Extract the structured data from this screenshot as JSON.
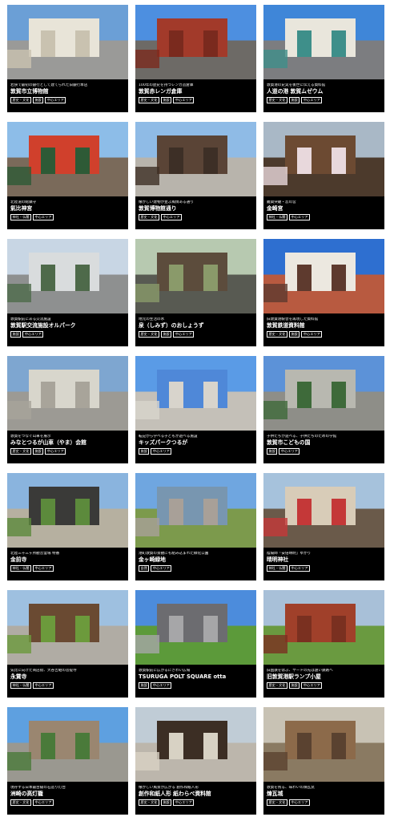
{
  "cards": [
    {
      "caption": "若狭で最初の銀行として建てられた旧銀行本店",
      "title": "敦賀市立博物館",
      "tags": [
        "歴史・文化",
        "施設",
        "中心エリア"
      ],
      "sky": "#6b9fd6",
      "ground": "#9a9a98",
      "building": "#e8e4d8",
      "accent": "#c9c2b0"
    },
    {
      "caption": "100年の歴史を持つレンガ造倉庫",
      "title": "敦賀赤レンガ倉庫",
      "tags": [
        "歴史・文化",
        "施設",
        "中心エリア"
      ],
      "sky": "#4d8fe0",
      "ground": "#6d6a66",
      "building": "#a23a2a",
      "accent": "#7a2a1e"
    },
    {
      "caption": "敦賀港の史実を後世に伝える資料館",
      "title": "人道の港 敦賀ムゼウム",
      "tags": [
        "歴史・文化",
        "施設",
        "中心エリア"
      ],
      "sky": "#3f86d8",
      "ground": "#7c7d80",
      "building": "#e9e6dc",
      "accent": "#3e8f8a"
    },
    {
      "caption": "北陸道の総鎮守",
      "title": "氣比神宮",
      "tags": [
        "神社・仏閣",
        "中心エリア"
      ],
      "sky": "#8dbde8",
      "ground": "#7a6a5a",
      "building": "#d0402c",
      "accent": "#2e5a36"
    },
    {
      "caption": "懐かしい建物が並ぶ風情ある通り",
      "title": "敦賀博物館通り",
      "tags": [
        "歴史・文化",
        "中心エリア"
      ],
      "sky": "#8fbbe6",
      "ground": "#b8b4ac",
      "building": "#5a4436",
      "accent": "#3d2f26"
    },
    {
      "caption": "難関突破・恋の宮",
      "title": "金崎宮",
      "tags": [
        "神社・仏閣",
        "中心エリア"
      ],
      "sky": "#a9b8c6",
      "ground": "#4c3a2c",
      "building": "#6c4a32",
      "accent": "#e8d8dc"
    },
    {
      "caption": "敦賀駅前にある交流施設",
      "title": "敦賀駅交流施設オルパーク",
      "tags": [
        "施設",
        "中心エリア"
      ],
      "sky": "#c8d6e4",
      "ground": "#8e9090",
      "building": "#d9dcdd",
      "accent": "#4e6a4a"
    },
    {
      "caption": "地元の生活の水",
      "title": "泉（しみず）のおしょうず",
      "tags": [
        "歴史・文化",
        "施設",
        "中心エリア"
      ],
      "sky": "#b7c9b0",
      "ground": "#585a52",
      "building": "#5c4c3c",
      "accent": "#8a9a6a"
    },
    {
      "caption": "旧敦賀港駅舎を再現した資料館",
      "title": "敦賀鉄道資料館",
      "tags": [
        "歴史・文化",
        "施設",
        "中心エリア"
      ],
      "sky": "#2e6fd0",
      "ground": "#b85a40",
      "building": "#ece8e0",
      "accent": "#5e3a2e"
    },
    {
      "caption": "敦賀をつなぐ山車を展示",
      "title": "みなとつるが山車（やま）会館",
      "tags": [
        "歴史・文化",
        "施設",
        "中心エリア"
      ],
      "sky": "#7ea6d0",
      "ground": "#9c9a94",
      "building": "#d8d6cc",
      "accent": "#a8a49a"
    },
    {
      "caption": "転記から学べる子どもが遊べる施設",
      "title": "キッズパークつるが",
      "tags": [
        "施設",
        "中心エリア"
      ],
      "sky": "#5a9be6",
      "ground": "#c4c0b8",
      "building": "#4f88d8",
      "accent": "#d8d4cc"
    },
    {
      "caption": "子供たちが遊べる、子供たちのための学館",
      "title": "敦賀市こどもの国",
      "tags": [
        "施設",
        "中心エリア"
      ],
      "sky": "#5c92d8",
      "ground": "#8e8e88",
      "building": "#b8b8b0",
      "accent": "#3e6a3a"
    },
    {
      "caption": "北陸三十三ヶ所観音霊場 特番",
      "title": "金前寺",
      "tags": [
        "神社・仏閣",
        "中心エリア"
      ],
      "sky": "#8ab4de",
      "ground": "#b6b0a0",
      "building": "#3a3a38",
      "accent": "#5c8a3c"
    },
    {
      "caption": "港町敦賀の景観にも組み込まれた緑化公園",
      "title": "金ヶ崎緑地",
      "tags": [
        "自然",
        "中心エリア"
      ],
      "sky": "#6fa6e0",
      "ground": "#7c9a4c",
      "building": "#7896b0",
      "accent": "#a8a098"
    },
    {
      "caption": "陰陽師「安倍晴明」ゆかり",
      "title": "晴明神社",
      "tags": [
        "神社・仏閣",
        "中心エリア"
      ],
      "sky": "#a6c2dc",
      "ground": "#6a5a4a",
      "building": "#d8ccb8",
      "accent": "#c43838"
    },
    {
      "caption": "気比に向けた商店街、大谷吉継の菩提寺",
      "title": "永賞寺",
      "tags": [
        "神社・仏閣",
        "中心エリア"
      ],
      "sky": "#9ec0e0",
      "ground": "#b0aca4",
      "building": "#6a4a32",
      "accent": "#6c9a3c"
    },
    {
      "caption": "敦賀駅前に広がるにぎわい広場",
      "title": "TSURUGA POLT SQUARE otta",
      "tags": [
        "施設",
        "中心エリア"
      ],
      "sky": "#4c8cdc",
      "ground": "#5c9a3a",
      "building": "#6c6c70",
      "accent": "#a6a6a8"
    },
    {
      "caption": "旧国鉄を偲ぶ、ヤードの先は遠い鉄路へ",
      "title": "旧敦賀港駅ランプ小屋",
      "tags": [
        "歴史・文化",
        "施設",
        "中心エリア"
      ],
      "sky": "#a8c0d8",
      "ground": "#6a9a40",
      "building": "#a0402a",
      "accent": "#7a3020"
    },
    {
      "caption": "現存する日本最古級の石造り灯台",
      "title": "洲崎の高灯籠",
      "tags": [
        "歴史・文化",
        "中心エリア"
      ],
      "sky": "#5ea0e0",
      "ground": "#9a9890",
      "building": "#9a8670",
      "accent": "#4a7a3a"
    },
    {
      "caption": "懐かしい風景が広がる 創作和紙人形",
      "title": "創作和紙人形 紙わらべ資料館",
      "tags": [
        "歴史・文化",
        "施設",
        "中心エリア"
      ],
      "sky": "#c0ccd6",
      "ground": "#bcb6ac",
      "building": "#3c2e24",
      "accent": "#d8d2c4"
    },
    {
      "caption": "敦賀を残る、味わいの煉瓦窯",
      "title": "煉瓦城",
      "tags": [
        "歴史・文化",
        "中心エリア"
      ],
      "sky": "#c8c2b4",
      "ground": "#8a7a62",
      "building": "#8c6a4a",
      "accent": "#5a4230"
    }
  ]
}
